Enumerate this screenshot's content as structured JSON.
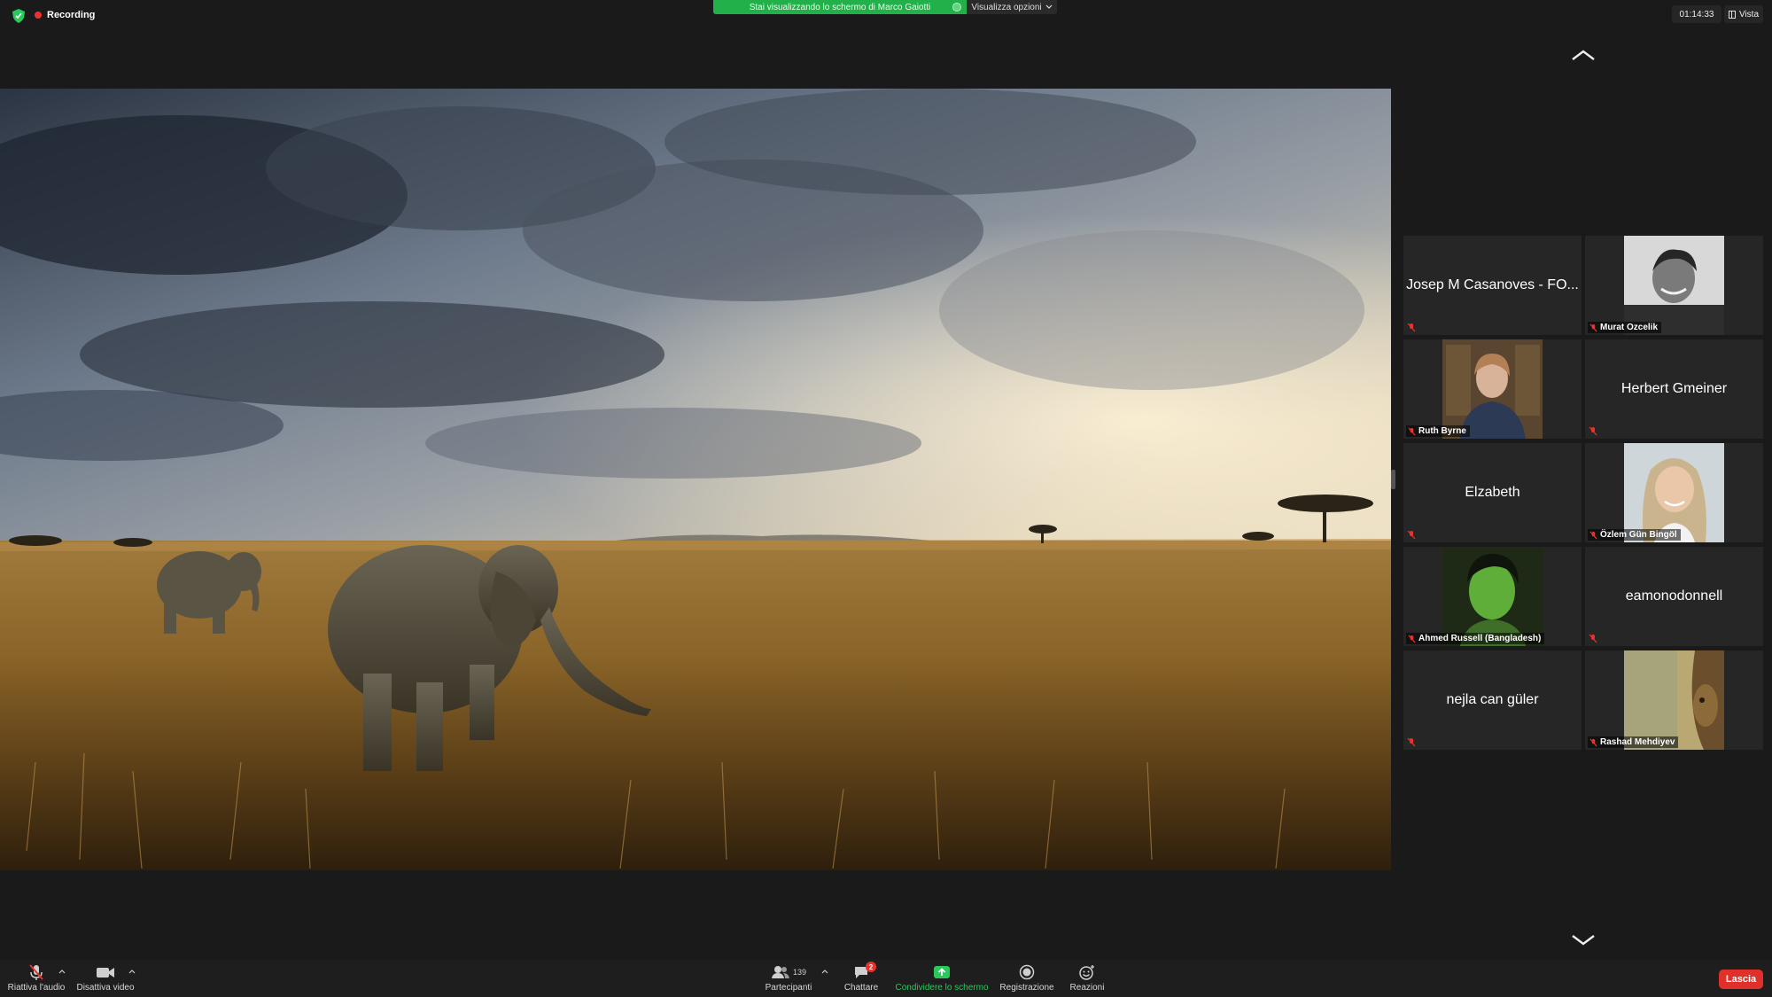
{
  "topbar": {
    "recording_label": "Recording",
    "share_banner": "Stai visualizzando lo schermo di Marco Gaiotti",
    "view_options": "Visualizza opzioni",
    "timer": "01:14:33",
    "view_label": "Vista"
  },
  "gallery": {
    "tiles": [
      {
        "name": "Josep M Casanoves - FO...",
        "has_video": false
      },
      {
        "name": "Murat Ozcelik",
        "has_video": true
      },
      {
        "name": "Ruth Byrne",
        "has_video": true
      },
      {
        "name": "Herbert Gmeiner",
        "has_video": false
      },
      {
        "name": "Elzabeth",
        "has_video": false
      },
      {
        "name": "Özlem Gün Bingöl",
        "has_video": true
      },
      {
        "name": "Ahmed Russell (Bangladesh)",
        "has_video": true
      },
      {
        "name": "eamonodonnell",
        "has_video": false
      },
      {
        "name": "nejla can güler",
        "has_video": false
      },
      {
        "name": "Rashad Mehdiyev",
        "has_video": true
      }
    ]
  },
  "toolbar": {
    "unmute_label": "Riattiva l'audio",
    "video_label": "Disattiva video",
    "participants_label": "Partecipanti",
    "participants_count": "139",
    "chat_label": "Chattare",
    "chat_badge": "2",
    "share_label": "Condividere lo schermo",
    "record_label": "Registrazione",
    "reactions_label": "Reazioni",
    "leave_label": "Lascia"
  },
  "colors": {
    "background": "#1a1a1a",
    "tile": "#262626",
    "share_green": "#21b04a",
    "leave_red": "#e0302a",
    "recording_red": "#e8322c"
  }
}
